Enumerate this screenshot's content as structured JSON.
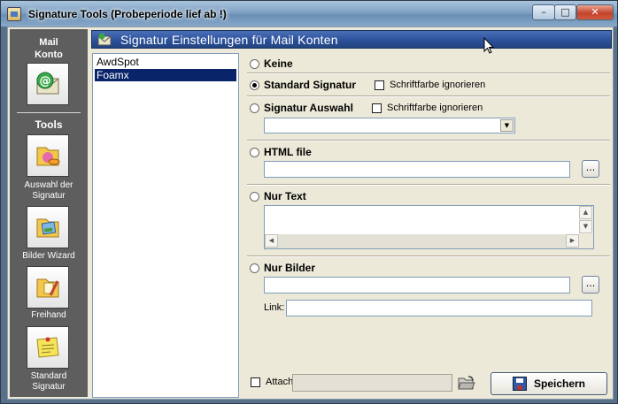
{
  "window": {
    "title": "Signature Tools (Probeperiode lief ab !)",
    "buttons": {
      "minimize": "–",
      "maximize": "□",
      "close": "✕"
    }
  },
  "sidebar": {
    "mail_section_title": "Mail Konto",
    "tools_section_title": "Tools",
    "tools": [
      {
        "label": "Auswahl der Signatur",
        "icon": "signature-selection-icon"
      },
      {
        "label": "Bilder Wizard",
        "icon": "image-wizard-icon"
      },
      {
        "label": "Freihand",
        "icon": "freehand-icon"
      },
      {
        "label": "Standard Signatur",
        "icon": "sticky-note-icon"
      }
    ]
  },
  "header": {
    "title": "Signatur Einstellungen für Mail Konten"
  },
  "accounts": {
    "items": [
      "AwdSpot",
      "Foamx"
    ],
    "selected": "Foamx"
  },
  "options": {
    "keine": "Keine",
    "standard": "Standard Signatur",
    "auswahl": "Signatur Auswahl",
    "html_file": "HTML file",
    "nur_text": "Nur Text",
    "nur_bilder": "Nur Bilder",
    "selected": "standard"
  },
  "checkboxes": {
    "ignore_font_color": "Schriftfarbe ignorieren"
  },
  "fields": {
    "signature_combo_value": "",
    "html_file_path": "",
    "text_content": "",
    "image_path": "",
    "link_label": "Link:",
    "link_value": "",
    "browse_label": "..."
  },
  "footer": {
    "attach_label": "Attach",
    "attach_value": "",
    "save_label": "Speichern"
  },
  "colors": {
    "header_bg": "#2a4f98",
    "sidebar_bg": "#5e5e5e",
    "selection_bg": "#0a246a",
    "client_bg": "#ece9d8"
  }
}
